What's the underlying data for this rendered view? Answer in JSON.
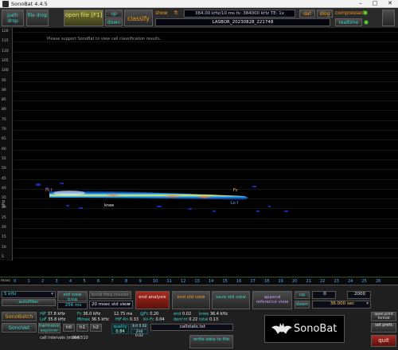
{
  "window": {
    "title": "SonoBat 4.4.5",
    "minimize": "–",
    "maximize": "□",
    "close": "✕"
  },
  "toolbar": {
    "path_drop": "path drop",
    "file_drop": "file drop",
    "open_file": "open file [F1]",
    "up": "up",
    "down": "down",
    "classify": "classify",
    "show": "show",
    "show_value": "ft",
    "recording_info": "384.00 kHz/10 ms   fs: 384000 kHz   TE: 1x",
    "filename": "LASBOR_20230828_221748",
    "dat": "dat",
    "dlog": "dlog",
    "compressed": "compressed",
    "realtime": "realtime",
    "colors": {
      "cyan": "#39d7c8",
      "orange": "#f39a1f",
      "green": "#5fcf3a"
    }
  },
  "plot": {
    "message": "Please support SonoBat to view call classification results.",
    "y_ticks": [
      "120",
      "115",
      "110",
      "105",
      "100",
      "95",
      "90",
      "85",
      "80",
      "75",
      "70",
      "65",
      "60",
      "55",
      "50",
      "45",
      "40",
      "35",
      "30",
      "25",
      "20",
      "15",
      "10",
      "5"
    ],
    "y_unit": "kHz",
    "call_labels": {
      "hi": "Hi f",
      "knee": "knee",
      "fc": "Fc",
      "lof": "Lo f"
    }
  },
  "x_axis": {
    "unit": "msec",
    "ticks": [
      "0",
      "1",
      "2",
      "3",
      "4",
      "5",
      "6",
      "7",
      "8",
      "9",
      "10",
      "11",
      "12",
      "13",
      "14",
      "15",
      "16",
      "17",
      "18",
      "19",
      "20",
      "21",
      "22",
      "23",
      "24",
      "25",
      "26"
    ]
  },
  "controls": {
    "freq_select": "5 kHz",
    "autofilter": "autofilter",
    "std_view_time_label": "std view time",
    "std_view_time_value": "256 ms",
    "build_freq_master": "build freq master",
    "std_view_select": "20 msec std view",
    "end_analysis": "end analysis",
    "end_std_view": "end std view",
    "save_std_view": "save std view",
    "append_reference_view": "append reference view",
    "up": "up",
    "down": "down",
    "range_start": "0",
    "range_end": "2000",
    "duration_select": "36.000 sec",
    "sonobatch": "SonoBatch",
    "sonovet": "SonoVet",
    "harmonic_explorer": "harmonic explorer",
    "h0": "h0",
    "h1": "h1",
    "h2": "h2",
    "call_intervals_label": "call intervals (msec):",
    "call_intervals_value": "264  510",
    "write_data": "write data to file",
    "callstats": "callstats.txt",
    "quality_label": "quality",
    "quality_value": "0.84",
    "third_label": "3rd",
    "third_value": "0.02",
    "second_label": "2nd",
    "second_value": "0.02",
    "open_print_format": "open print format",
    "set_prefs": "set prefs",
    "quit": "quit",
    "logo_text": "SonoBat"
  },
  "params": {
    "hif_label": "HiF",
    "hif_value": "37.8 kHz",
    "lof_label": "LoF",
    "lof_value": "35.8 kHz",
    "fc_label": "Fc",
    "fc_value": "36.0 kHz",
    "fbmax_label": "fBmax",
    "fbmax_value": "36.5 kHz",
    "dur_value": "12.75 ms",
    "atfc_label": "@Fc",
    "atfc_value": "0.20",
    "hiKn_label": "HiF-Kn",
    "hiKn_value": "0.33",
    "knfc_label": "Kn-Fc",
    "knfc_value": "0.04",
    "end_label": "end",
    "end_value": "0.02",
    "domnt_label": "dom'nt",
    "domnt_value": "0.22",
    "knee_label": "knee",
    "knee_value": "36.4 kHz",
    "total_label": "total",
    "total_value": "0.13"
  }
}
